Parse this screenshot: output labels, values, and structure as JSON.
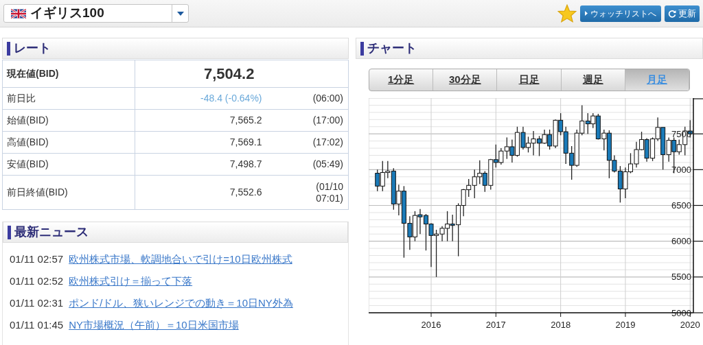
{
  "header": {
    "instrument": "イギリス100",
    "watchlist_button": "ウォッチリストへ",
    "refresh_button": "更新"
  },
  "rate": {
    "title": "レート",
    "current": {
      "label": "現在値(BID)",
      "value": "7,504.2"
    },
    "rows": [
      {
        "kind": "change",
        "label": "前日比",
        "value": "-48.4 (-0.64%)",
        "time": "(06:00)"
      },
      {
        "kind": "price",
        "label": "始値(BID)",
        "value": "7,565.2",
        "time": "(17:00)"
      },
      {
        "kind": "price",
        "label": "高値(BID)",
        "value": "7,569.1",
        "time": "(17:02)"
      },
      {
        "kind": "price",
        "label": "安値(BID)",
        "value": "7,498.7",
        "time": "(05:49)"
      },
      {
        "kind": "price",
        "label": "前日終値(BID)",
        "value": "7,552.6",
        "time": "(01/10 07:01)"
      }
    ]
  },
  "news": {
    "title": "最新ニュース",
    "items": [
      {
        "time": "01/11 02:57",
        "title": "欧州株式市場、軟調地合いで引け=10日欧州株式"
      },
      {
        "time": "01/11 02:52",
        "title": "欧州株式引け＝揃って下落"
      },
      {
        "time": "01/11 02:31",
        "title": "ポンド/ドル、狭いレンジでの動き＝10日NY外為"
      },
      {
        "time": "01/11 01:45",
        "title": "NY市場概況（午前）＝10日米国市場"
      }
    ]
  },
  "chart": {
    "title": "チャート",
    "tabs": [
      {
        "label": "1分足",
        "selected": false
      },
      {
        "label": "30分足",
        "selected": false
      },
      {
        "label": "日足",
        "selected": false
      },
      {
        "label": "週足",
        "selected": false
      },
      {
        "label": "月足",
        "selected": true
      }
    ],
    "chart_data": {
      "type": "candlestick",
      "grid": true,
      "xlim": [
        2015.035,
        2020.05
      ],
      "ylim": [
        5000,
        8000
      ],
      "xticks": [
        2016,
        2017,
        2018,
        2019,
        2020
      ],
      "yticks": [
        5000,
        5500,
        6000,
        6500,
        7000,
        7500
      ],
      "x": [
        2015.17,
        2015.25,
        2015.33,
        2015.42,
        2015.5,
        2015.58,
        2015.67,
        2015.75,
        2015.83,
        2015.92,
        2016,
        2016.08,
        2016.17,
        2016.25,
        2016.33,
        2016.42,
        2016.5,
        2016.58,
        2016.67,
        2016.75,
        2016.83,
        2016.92,
        2017,
        2017.08,
        2017.17,
        2017.25,
        2017.33,
        2017.42,
        2017.5,
        2017.58,
        2017.67,
        2017.75,
        2017.83,
        2017.92,
        2018,
        2018.08,
        2018.17,
        2018.25,
        2018.33,
        2018.42,
        2018.5,
        2018.58,
        2018.67,
        2018.75,
        2018.83,
        2018.92,
        2019,
        2019.08,
        2019.17,
        2019.25,
        2019.33,
        2019.42,
        2019.5,
        2019.58,
        2019.67,
        2019.75,
        2019.83,
        2019.92,
        2020
      ],
      "ohlc": [
        [
          6950,
          7000,
          6700,
          6770
        ],
        [
          6770,
          7120,
          6700,
          6960
        ],
        [
          6960,
          7120,
          6880,
          6980
        ],
        [
          6980,
          7020,
          6440,
          6520
        ],
        [
          6520,
          6790,
          6360,
          6700
        ],
        [
          6700,
          6770,
          5770,
          6250
        ],
        [
          6250,
          6350,
          5880,
          6060
        ],
        [
          6060,
          6420,
          6000,
          6360
        ],
        [
          6370,
          6450,
          6100,
          6340
        ],
        [
          6360,
          6380,
          5870,
          6240
        ],
        [
          6240,
          6250,
          5640,
          6080
        ],
        [
          6080,
          6160,
          5500,
          6100
        ],
        [
          6100,
          6210,
          6000,
          6180
        ],
        [
          6180,
          6420,
          6000,
          6240
        ],
        [
          6240,
          6370,
          6000,
          6230
        ],
        [
          6230,
          6530,
          5790,
          6500
        ],
        [
          6500,
          6730,
          6350,
          6720
        ],
        [
          6720,
          6870,
          6620,
          6780
        ],
        [
          6780,
          7000,
          6600,
          6900
        ],
        [
          6900,
          7130,
          6800,
          6950
        ],
        [
          6950,
          6980,
          6690,
          6780
        ],
        [
          6780,
          7150,
          6720,
          7140
        ],
        [
          7140,
          7350,
          7030,
          7100
        ],
        [
          7100,
          7300,
          7070,
          7260
        ],
        [
          7260,
          7450,
          7150,
          7320
        ],
        [
          7320,
          7420,
          7100,
          7200
        ],
        [
          7200,
          7600,
          7180,
          7520
        ],
        [
          7520,
          7600,
          7280,
          7310
        ],
        [
          7310,
          7460,
          7240,
          7370
        ],
        [
          7370,
          7540,
          7200,
          7430
        ],
        [
          7430,
          7470,
          7190,
          7370
        ],
        [
          7370,
          7560,
          7360,
          7490
        ],
        [
          7490,
          7560,
          7280,
          7330
        ],
        [
          7330,
          7700,
          7300,
          7690
        ],
        [
          7690,
          7790,
          7480,
          7530
        ],
        [
          7530,
          7600,
          7080,
          7230
        ],
        [
          7230,
          7330,
          6860,
          7060
        ],
        [
          7060,
          7560,
          7040,
          7510
        ],
        [
          7510,
          7900,
          7480,
          7680
        ],
        [
          7680,
          7790,
          7500,
          7640
        ],
        [
          7640,
          7790,
          7580,
          7750
        ],
        [
          7750,
          7780,
          7420,
          7430
        ],
        [
          7430,
          7560,
          7270,
          7510
        ],
        [
          7510,
          7550,
          6880,
          7130
        ],
        [
          7130,
          7200,
          6960,
          6980
        ],
        [
          6980,
          7050,
          6540,
          6730
        ],
        [
          6730,
          7030,
          6600,
          6970
        ],
        [
          6970,
          7230,
          6950,
          7080
        ],
        [
          7080,
          7390,
          7030,
          7280
        ],
        [
          7280,
          7530,
          7270,
          7420
        ],
        [
          7420,
          7440,
          7110,
          7160
        ],
        [
          7160,
          7450,
          7120,
          7430
        ],
        [
          7430,
          7730,
          7400,
          7590
        ],
        [
          7590,
          7590,
          7000,
          7210
        ],
        [
          7210,
          7450,
          7110,
          7410
        ],
        [
          7410,
          7450,
          6950,
          7250
        ],
        [
          7250,
          7420,
          7210,
          7350
        ],
        [
          7350,
          7600,
          7200,
          7540
        ],
        [
          7540,
          7690,
          7450,
          7500
        ]
      ]
    }
  }
}
